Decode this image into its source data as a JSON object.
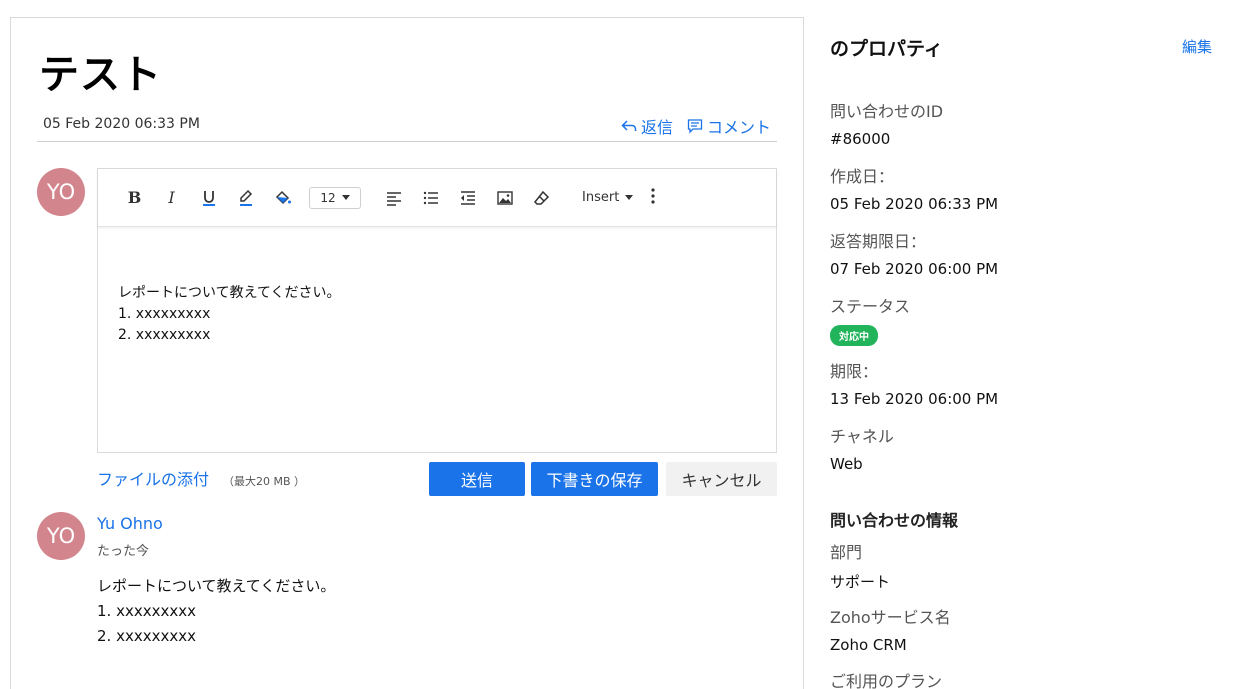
{
  "ticket": {
    "title": "テスト",
    "created": "05 Feb 2020 06:33 PM",
    "reply_label": "返信",
    "comment_label": "コメント"
  },
  "composer": {
    "avatar_initials": "YO",
    "font_size": "12",
    "insert_label": "Insert",
    "body_lines": [
      "レポートについて教えてください。",
      "1. xxxxxxxxx",
      "2. xxxxxxxxx"
    ],
    "attach_label": "ファイルの添付",
    "attach_note": "（最大20 MB ）",
    "send_label": "送信",
    "draft_label": "下書きの保存",
    "cancel_label": "キャンセル"
  },
  "thread": {
    "avatar_initials": "YO",
    "author": "Yu Ohno",
    "time": "たった今",
    "body_lines": [
      "レポートについて教えてください。",
      "1. xxxxxxxxx",
      "2. xxxxxxxxx"
    ]
  },
  "properties": {
    "title": "のプロパティ",
    "edit_label": "編集",
    "ticket_id_label": "問い合わせのID",
    "ticket_id": "#86000",
    "created_label": "作成日：",
    "created_value": "05 Feb 2020 06:33 PM",
    "reply_due_label": "返答期限日：",
    "reply_due_value": "07 Feb 2020 06:00 PM",
    "status_label": "ステータス",
    "status_value": "対応中",
    "due_label": "期限：",
    "due_value": "13 Feb 2020 06:00 PM",
    "channel_label": "チャネル",
    "channel_value": "Web",
    "info_section": "問い合わせの情報",
    "dept_label": "部門",
    "dept_value": "サポート",
    "service_label": "Zohoサービス名",
    "service_value": "Zoho CRM",
    "plan_label": "ご利用のプラン"
  },
  "colors": {
    "accent": "#1a73e8",
    "avatar": "#d3858d",
    "status_badge": "#22b45a"
  }
}
